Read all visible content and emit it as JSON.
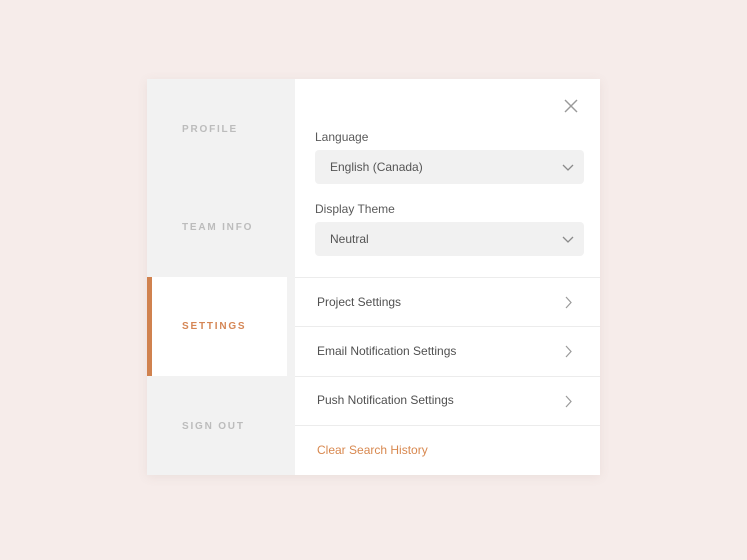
{
  "sidebar": {
    "items": [
      {
        "label": "PROFILE"
      },
      {
        "label": "TEAM INFO"
      },
      {
        "label": "SETTINGS"
      },
      {
        "label": "SIGN OUT"
      }
    ],
    "active_index": 2
  },
  "settings": {
    "language": {
      "label": "Language",
      "value": "English (Canada)"
    },
    "theme": {
      "label": "Display Theme",
      "value": "Neutral"
    },
    "rows": [
      {
        "label": "Project Settings"
      },
      {
        "label": "Email Notification Settings"
      },
      {
        "label": "Push Notification Settings"
      }
    ],
    "clear_history_label": "Clear Search History"
  },
  "icons": {
    "close": "close-icon",
    "select_chevron": "chevron-down-icon",
    "row_chevron": "chevron-right-icon"
  },
  "colors": {
    "background": "#f6ecea",
    "accent": "#d0824f",
    "sidebar": "#f2f2f2"
  }
}
